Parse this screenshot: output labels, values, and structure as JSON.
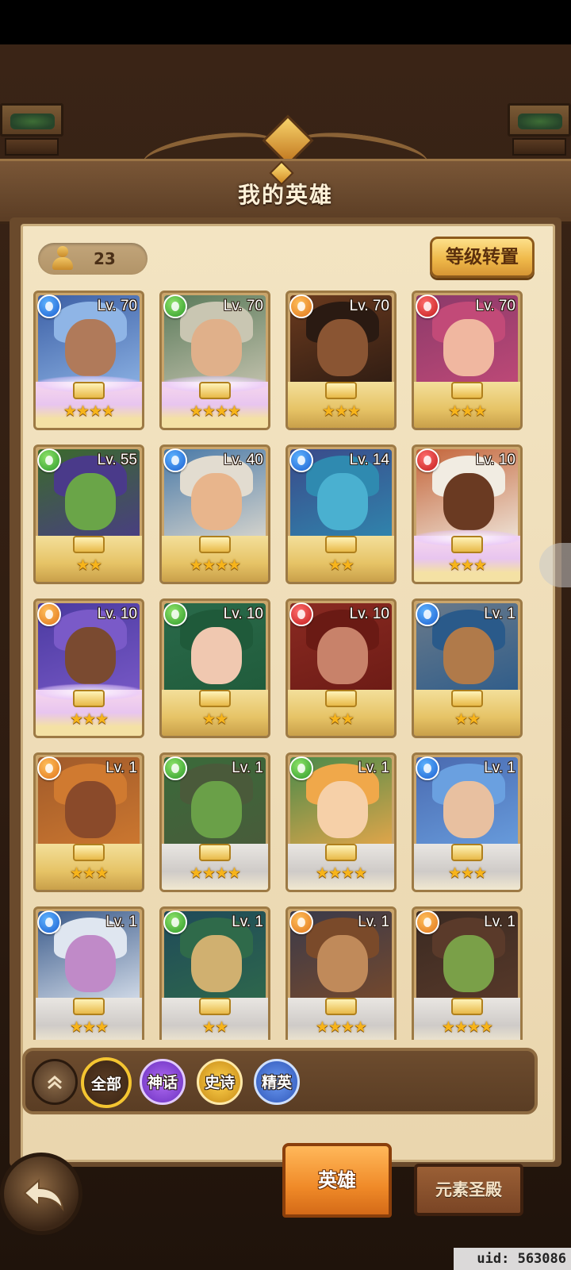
{
  "header": {
    "title": "我的英雄"
  },
  "hero_count": "23",
  "buttons": {
    "level_transfer": "等级转置"
  },
  "heroes": [
    {
      "level": "Lv. 70",
      "element": "water",
      "stars": 4,
      "rarity": "legend",
      "palette": [
        "#3c5fa5",
        "#8fb5e6",
        "#b07a5a"
      ]
    },
    {
      "level": "Lv. 70",
      "element": "wind",
      "stars": 4,
      "rarity": "legend",
      "palette": [
        "#5a7a5a",
        "#c9c6b2",
        "#e0b08a"
      ]
    },
    {
      "level": "Lv. 70",
      "element": "light",
      "stars": 3,
      "rarity": "epic",
      "palette": [
        "#6b3a1e",
        "#2a1a12",
        "#8a5533"
      ]
    },
    {
      "level": "Lv. 70",
      "element": "fire",
      "stars": 3,
      "rarity": "epic",
      "palette": [
        "#8b3a6a",
        "#c24a78",
        "#f0b7a0"
      ]
    },
    {
      "level": "Lv. 55",
      "element": "wind",
      "stars": 2,
      "rarity": "epic",
      "palette": [
        "#3b6a2b",
        "#4a3a8a",
        "#6aa548"
      ]
    },
    {
      "level": "Lv. 40",
      "element": "water",
      "stars": 4,
      "rarity": "epic",
      "palette": [
        "#4a7aa8",
        "#e2dcd0",
        "#e8b58c"
      ]
    },
    {
      "level": "Lv. 14",
      "element": "water",
      "stars": 2,
      "rarity": "epic",
      "palette": [
        "#3a4a8a",
        "#2f8ab0",
        "#4ab0d0"
      ]
    },
    {
      "level": "Lv. 10",
      "element": "fire",
      "stars": 3,
      "rarity": "legend",
      "palette": [
        "#c4653a",
        "#f1ece2",
        "#6a3a22"
      ]
    },
    {
      "level": "Lv. 10",
      "element": "light",
      "stars": 3,
      "rarity": "legend",
      "palette": [
        "#4a3aa0",
        "#7a5ac8",
        "#7a4a30"
      ]
    },
    {
      "level": "Lv. 10",
      "element": "wind",
      "stars": 2,
      "rarity": "epic",
      "palette": [
        "#2a6a4a",
        "#1f5a3a",
        "#f0c8b0"
      ]
    },
    {
      "level": "Lv. 10",
      "element": "fire",
      "stars": 2,
      "rarity": "epic",
      "palette": [
        "#8a2a22",
        "#6a1a14",
        "#c8826a"
      ]
    },
    {
      "level": "Lv. 1",
      "element": "water",
      "stars": 2,
      "rarity": "epic",
      "palette": [
        "#6a7a8a",
        "#2a5a8a",
        "#b07a4a"
      ]
    },
    {
      "level": "Lv. 1",
      "element": "light",
      "stars": 3,
      "rarity": "epic",
      "palette": [
        "#a05a2a",
        "#d07a30",
        "#8a4a2a"
      ]
    },
    {
      "level": "Lv. 1",
      "element": "wind",
      "stars": 4,
      "rarity": "plain",
      "palette": [
        "#3a6a3a",
        "#4a5a3a",
        "#6aa048"
      ]
    },
    {
      "level": "Lv. 1",
      "element": "wind",
      "stars": 4,
      "rarity": "plain",
      "palette": [
        "#4a8a4a",
        "#f0a84a",
        "#f6d0a8"
      ]
    },
    {
      "level": "Lv. 1",
      "element": "water",
      "stars": 3,
      "rarity": "plain",
      "palette": [
        "#4a6ab0",
        "#6aa0e0",
        "#e8c0a0"
      ]
    },
    {
      "level": "Lv. 1",
      "element": "water",
      "stars": 3,
      "rarity": "plain",
      "palette": [
        "#3a5a8a",
        "#dfe6f0",
        "#c08ac8"
      ]
    },
    {
      "level": "Lv. 1",
      "element": "wind",
      "stars": 2,
      "rarity": "plain",
      "palette": [
        "#1f4a5a",
        "#2f6a4a",
        "#d0b070"
      ]
    },
    {
      "level": "Lv. 1",
      "element": "light",
      "stars": 4,
      "rarity": "plain",
      "palette": [
        "#3a3a4a",
        "#7a4a2a",
        "#c08a5a"
      ]
    },
    {
      "level": "Lv. 1",
      "element": "light",
      "stars": 4,
      "rarity": "plain",
      "palette": [
        "#3a2a22",
        "#5a3a2a",
        "#7aa048"
      ]
    }
  ],
  "filters": {
    "all": "全部",
    "myth": "神话",
    "epic": "史诗",
    "elite": "精英"
  },
  "nav": {
    "heroes_tab": "英雄",
    "temple_tab": "元素圣殿"
  },
  "uid": "uid: 563086",
  "icons": {
    "back": "back-arrow-icon",
    "collapse": "double-chevron-up-icon",
    "count": "person-icon"
  }
}
